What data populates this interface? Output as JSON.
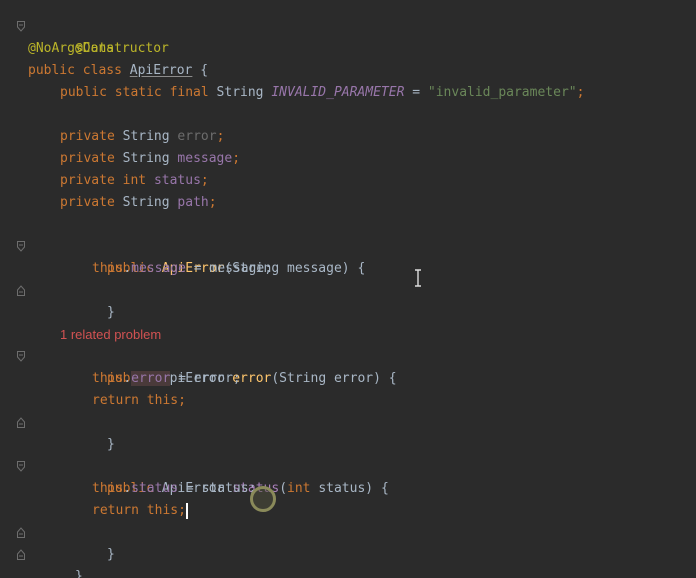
{
  "code": {
    "l1_annotation": "@Data",
    "l2_annotation": "@NoArgsConstructor",
    "l3_kw_public": "public",
    "l3_kw_class": "class",
    "l3_class_name": "ApiError",
    "l3_brace": " {",
    "l4_mods": "public static final",
    "l4_type": "String",
    "l4_const": "INVALID_PARAMETER",
    "l4_eq": " = ",
    "l4_str": "\"invalid_parameter\"",
    "l4_semi": ";",
    "l6_kw": "private",
    "l6_type": "String",
    "l6_field": "error",
    "l7_kw": "private",
    "l7_type": "String",
    "l7_field": "message",
    "l8_kw": "private",
    "l8_type": "int",
    "l8_field": "status",
    "l9_kw": "private",
    "l9_type": "String",
    "l9_field": "path",
    "semi": ";",
    "l11_kw": "public",
    "l11_method": "ApiError",
    "l11_params": "(String message) {",
    "l12_this": "this",
    "l12_field": "message",
    "l12_rest": " = message;",
    "close_brace": "}",
    "related_problem": "1 related problem",
    "l15_kw": "public",
    "l15_type": "ApiError",
    "l15_method": "error",
    "l15_params": "(String error) {",
    "l16_this": "this",
    "l16_field": "error",
    "l16_rest": " = error;",
    "l17_return": "return",
    "l17_this": "this",
    "l20_kw": "public",
    "l20_type": "ApiError",
    "l20_method": "status",
    "l20_params_open": "(",
    "l20_int": "int",
    "l20_params_rest": " status) {",
    "l21_this": "this",
    "l21_field": "status",
    "l21_rest": " = status;",
    "l22_return": "return",
    "l22_this": "this",
    "final_brace": "}"
  },
  "colors": {
    "background": "#2b2b2b",
    "keyword": "#cc7832",
    "annotation": "#bbb529",
    "field": "#9876aa",
    "string": "#6a8759",
    "method": "#ffc66d",
    "error_hint": "#d25252"
  },
  "icons": {
    "fold": "fold-marker-icon",
    "text_cursor": "ibeam-cursor-icon",
    "click_indicator": "click-ring-icon"
  }
}
